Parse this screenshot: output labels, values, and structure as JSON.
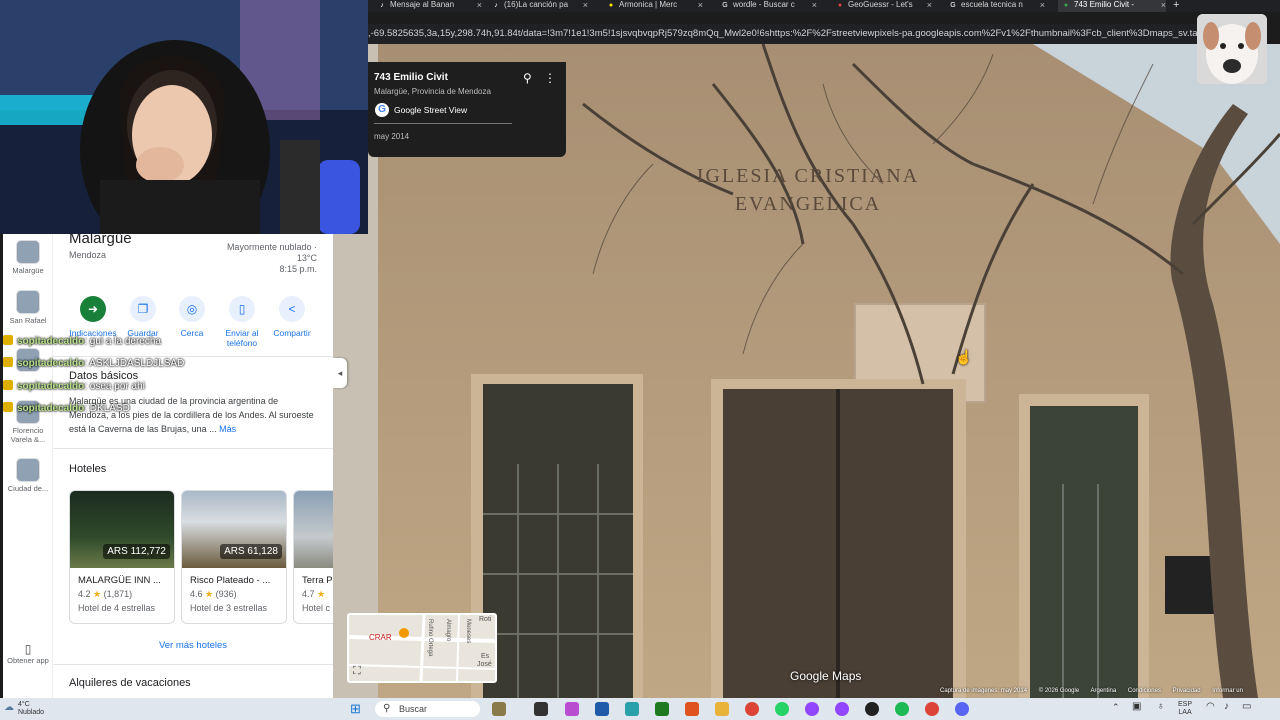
{
  "browser": {
    "tabs": [
      {
        "label": "Mensaje al Banan",
        "icon": "tiktok-icon"
      },
      {
        "label": "(16)La canción pa",
        "icon": "tiktok-icon"
      },
      {
        "label": "Armonica | Merc",
        "icon": "mercadolibre-icon"
      },
      {
        "label": "wordle - Buscar c",
        "icon": "google-icon"
      },
      {
        "label": "GeoGuessr - Let's",
        "icon": "geoguessr-icon"
      },
      {
        "label": "escuela tecnica n",
        "icon": "google-icon"
      },
      {
        "label": "743 Emilio Civit -",
        "icon": "maps-icon"
      }
    ],
    "close_glyph": "×",
    "new_tab_glyph": "+",
    "url": ",-69.5825635,3a,15y,298.74h,91.84t/data=!3m7!1e1!3m5!1sjsvqbvqpRj579zq8mQq_Mwl2e0!6shttps:%2F%2Fstreetviewpixels-pa.googleapis.com%2Fv1%2Fthumbnail%3Fcb_client%3Dmaps_sv.tactil"
  },
  "streetview": {
    "address": "743 Emilio Civit",
    "locality": "Malargüe, Provincia de Mendoza",
    "provider": "Google Street View",
    "provider_icon_letter": "G",
    "capture_date": "may 2014",
    "sign_text": "IGLESIA CRISTIANA EVANGELICA",
    "watermark": "Google Maps",
    "footer": [
      "Captura de imágenes: may 2014",
      "© 2026 Google",
      "Argentina",
      "Condiciones",
      "Privacidad",
      "Informar un"
    ],
    "collapse_glyph": "◂"
  },
  "minimap": {
    "labels": [
      "Rufino Ortega",
      "Almagro",
      "Meneses",
      "CRAR",
      "Roti",
      "Es",
      "José"
    ]
  },
  "place": {
    "name": "Malargüe",
    "region": "Mendoza",
    "weather": {
      "condition": "Mayormente nublado ·",
      "temp": "13°C",
      "time": "8:15 p.m."
    },
    "actions": [
      {
        "label": "Indicaciones",
        "icon": "directions-icon",
        "glyph": "➜"
      },
      {
        "label": "Guardar",
        "icon": "bookmark-icon",
        "glyph": "❐"
      },
      {
        "label": "Cerca",
        "icon": "nearby-icon",
        "glyph": "◎"
      },
      {
        "label": "Enviar al teléfono",
        "icon": "send-to-phone-icon",
        "glyph": "▯"
      },
      {
        "label": "Compartir",
        "icon": "share-icon",
        "glyph": "<"
      }
    ],
    "about_title": "Datos básicos",
    "about_text": "Malargüe es una ciudad de la provincia argentina de Mendoza, a los pies de la cordillera de los Andes. Al suroeste está la Caverna de las Brujas, una ...",
    "about_more": "Más",
    "hotels_title": "Hoteles",
    "hotels": [
      {
        "name": "MALARGÜE INN ...",
        "price": "ARS 112,772",
        "rating": "4.2",
        "reviews": "(1,871)",
        "class": "Hotel de 4 estrellas"
      },
      {
        "name": "Risco Plateado - ...",
        "price": "ARS 61,128",
        "rating": "4.6",
        "reviews": "(936)",
        "class": "Hotel de 3 estrellas"
      },
      {
        "name": "Terra P",
        "price": "",
        "rating": "4.7",
        "reviews": "",
        "class": "Hotel c"
      }
    ],
    "more_hotels": "Ver más hoteles",
    "rentals_title": "Alquileres de vacaciones",
    "star_glyph": "★"
  },
  "recent": [
    {
      "label": "Malargüe"
    },
    {
      "label": "San Rafael"
    },
    {
      "label": ""
    },
    {
      "label": "Florencio Varela &..."
    },
    {
      "label": "Ciudad de..."
    }
  ],
  "get_app": "Obtener app",
  "chat": [
    {
      "user": "sopitadecaldo",
      "msg": ": gui a la derecha"
    },
    {
      "user": "sopitadecaldo",
      "msg": ": ASKLJDASLDJLSAD"
    },
    {
      "user": "sopitadecaldo",
      "msg": ": osea por ahi"
    },
    {
      "user": "sopitadecaldo",
      "msg": ": DKLASD"
    }
  ],
  "taskbar": {
    "weather_temp": "4°C",
    "weather_desc": "Nublado",
    "search_placeholder": "Buscar",
    "lang": "ESP",
    "lang2": "LAA"
  }
}
